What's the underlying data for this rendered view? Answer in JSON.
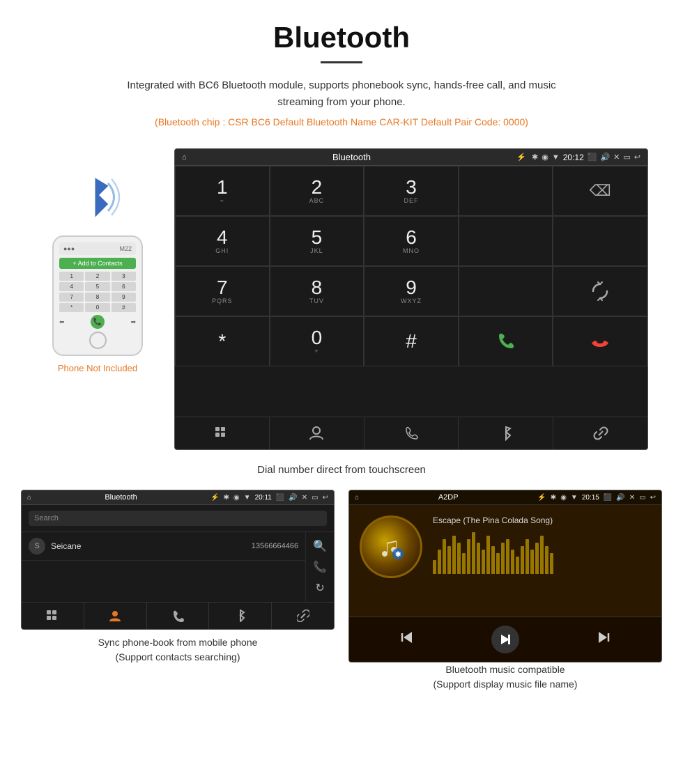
{
  "page": {
    "title": "Bluetooth",
    "description": "Integrated with BC6 Bluetooth module, supports phonebook sync, hands-free call, and music streaming from your phone.",
    "specs": "(Bluetooth chip : CSR BC6    Default Bluetooth Name CAR-KIT    Default Pair Code: 0000)",
    "phone_not_included": "Phone Not Included",
    "dial_caption": "Dial number direct from touchscreen",
    "phonebook_caption": "Sync phone-book from mobile phone\n(Support contacts searching)",
    "music_caption": "Bluetooth music compatible\n(Support display music file name)"
  },
  "status_bar": {
    "home_icon": "⌂",
    "title": "Bluetooth",
    "usb_icon": "⚡",
    "bt_icon": "✱",
    "location_icon": "◉",
    "signal_icon": "▼",
    "time": "20:12",
    "camera_icon": "📷",
    "volume_icon": "🔊",
    "close_icon": "✕",
    "window_icon": "▭",
    "back_icon": "↩"
  },
  "dialpad": {
    "keys": [
      {
        "num": "1",
        "letters": ""
      },
      {
        "num": "2",
        "letters": "ABC"
      },
      {
        "num": "3",
        "letters": "DEF"
      },
      {
        "num": "",
        "letters": ""
      },
      {
        "num": "⌫",
        "letters": ""
      },
      {
        "num": "4",
        "letters": "GHI"
      },
      {
        "num": "5",
        "letters": "JKL"
      },
      {
        "num": "6",
        "letters": "MNO"
      },
      {
        "num": "",
        "letters": ""
      },
      {
        "num": "",
        "letters": ""
      },
      {
        "num": "7",
        "letters": "PQRS"
      },
      {
        "num": "8",
        "letters": "TUV"
      },
      {
        "num": "9",
        "letters": "WXYZ"
      },
      {
        "num": "",
        "letters": ""
      },
      {
        "num": "↻",
        "letters": ""
      },
      {
        "num": "*",
        "letters": ""
      },
      {
        "num": "0",
        "letters": "+"
      },
      {
        "num": "#",
        "letters": ""
      },
      {
        "num": "📞",
        "letters": "green"
      },
      {
        "num": "📵",
        "letters": "red"
      }
    ]
  },
  "nav_bar": {
    "items": [
      "⊞",
      "👤",
      "📞",
      "✱",
      "🔗"
    ]
  },
  "phonebook": {
    "status_title": "Bluetooth",
    "status_time": "20:11",
    "search_placeholder": "Search",
    "contacts": [
      {
        "initial": "S",
        "name": "Seicane",
        "number": "13566664466"
      }
    ],
    "right_icons": [
      "🔍",
      "📞",
      "↻"
    ],
    "nav_items": [
      "⊞",
      "👤",
      "📞",
      "✱",
      "🔗"
    ]
  },
  "music": {
    "status_title": "A2DP",
    "status_time": "20:15",
    "song_title": "Escape (The Pina Colada Song)",
    "bt_symbol": "✱",
    "controls": {
      "prev": "⏮",
      "play_pause": "⏯",
      "next": "⏭"
    },
    "eq_bars": [
      20,
      35,
      50,
      40,
      55,
      45,
      30,
      50,
      60,
      45,
      35,
      55,
      40,
      30,
      45,
      50,
      35,
      25,
      40,
      50,
      35,
      45,
      55,
      40,
      30
    ]
  }
}
